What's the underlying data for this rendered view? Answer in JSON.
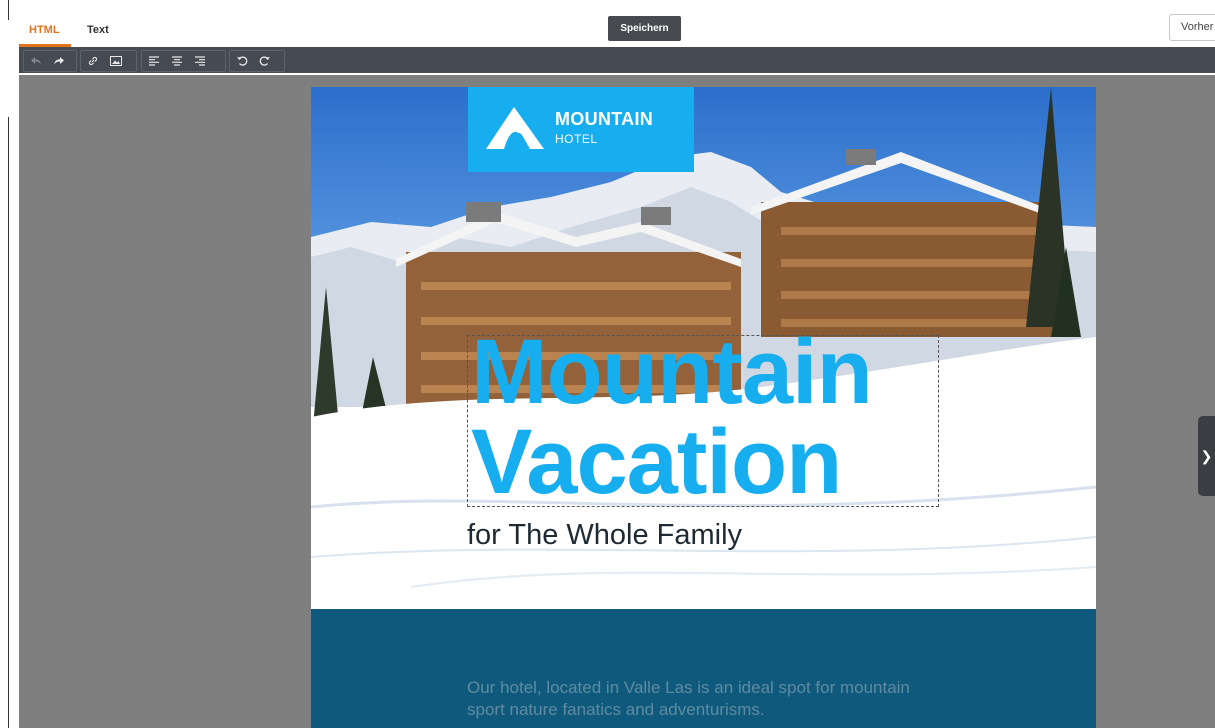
{
  "tabs": [
    {
      "label": "HTML",
      "active": true
    },
    {
      "label": "Text",
      "active": false
    }
  ],
  "save_label": "Speichern",
  "preview_label": "Vorher",
  "toolbar": {
    "buttons": [
      "undo-icon",
      "redo-icon",
      "link-icon",
      "image-icon",
      "align-left-icon",
      "align-center-icon",
      "align-right-icon",
      "rotate-left-icon",
      "rotate-right-icon"
    ],
    "undo_disabled": true
  },
  "template": {
    "logo_main": "MOUNTAIN",
    "logo_sub": "HOTEL",
    "headline_line1": "Mountain",
    "headline_line2": "Vacation",
    "subtitle": "for The Whole Family",
    "body_text": "Our hotel, located in Valle Las is an ideal spot for mountain sport nature fanatics and adventurisms."
  },
  "colors": {
    "accent_orange": "#e07418",
    "brand_blue": "#17aef0",
    "band_navy": "#0f5a7c",
    "toolbar_dark": "#454a53",
    "canvas_gray": "#7f7f7f"
  }
}
